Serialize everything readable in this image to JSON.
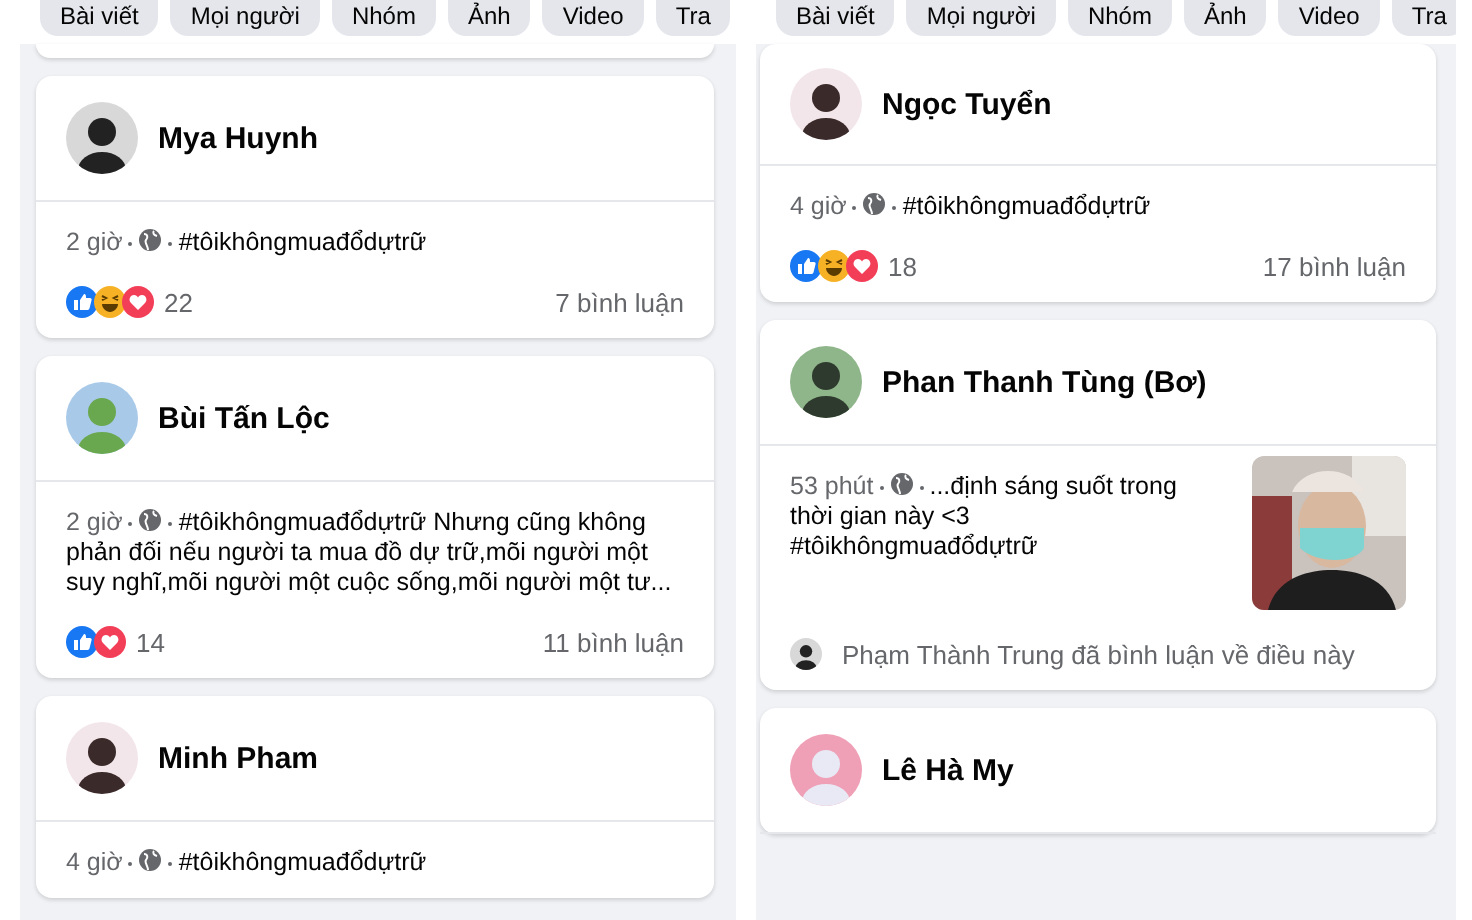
{
  "panels": [
    {
      "chips": [
        "Bài viết",
        "Mọi người",
        "Nhóm",
        "Ảnh",
        "Video",
        "Tra"
      ],
      "posts": [
        {
          "kind": "stub"
        },
        {
          "kind": "post",
          "author": "Mya Huynh",
          "time": "2 giờ",
          "text": "#tôikhôngmuađổdựtrữ",
          "reactions": [
            {
              "kind": "like"
            },
            {
              "kind": "haha"
            },
            {
              "kind": "love"
            }
          ],
          "count": "22",
          "comments": "7 bình luận"
        },
        {
          "kind": "post",
          "author": "Bùi Tấn Lộc",
          "time": "2 giờ",
          "text": "#tôikhôngmuađổdựtrữ Nhưng cũng không phản đối nếu người ta mua đồ dự trữ,mõi người một suy nghĩ,mõi người một cuộc sống,mõi người một tư...",
          "reactions": [
            {
              "kind": "like"
            },
            {
              "kind": "love"
            }
          ],
          "count": "14",
          "comments": "11 bình luận"
        },
        {
          "kind": "post",
          "author": "Minh Pham",
          "time": "4 giờ",
          "text": "#tôikhôngmuađổdựtrữ"
        }
      ]
    },
    {
      "chips": [
        "Bài viết",
        "Mọi người",
        "Nhóm",
        "Ảnh",
        "Video",
        "Tra"
      ],
      "posts": [
        {
          "kind": "post",
          "author": "Ngọc Tuyển",
          "time": "4 giờ",
          "text": "#tôikhôngmuađổdựtrữ",
          "reactions": [
            {
              "kind": "like"
            },
            {
              "kind": "haha"
            },
            {
              "kind": "love"
            }
          ],
          "count": "18",
          "comments": "17 bình luận"
        },
        {
          "kind": "post",
          "author": "Phan Thanh Tùng (Bơ)",
          "time": "53 phút",
          "text": "...định sáng suốt trong\nthời gian này <3\n#tôikhôngmuađổdựtrữ",
          "commented": "Phạm Thành Trung đã bình luận về điều này"
        },
        {
          "kind": "post",
          "author": "Lê Hà My"
        }
      ]
    }
  ]
}
